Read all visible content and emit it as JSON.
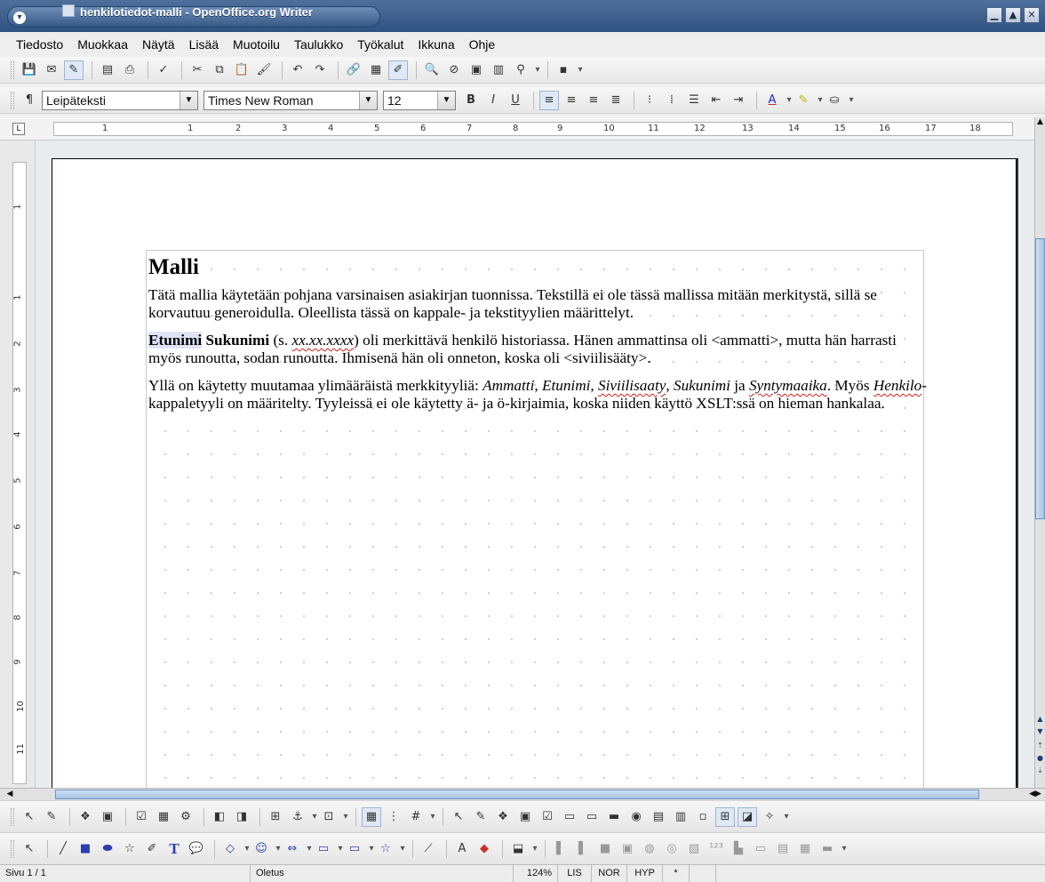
{
  "window": {
    "title": "henkilotiedot-malli - OpenOffice.org Writer"
  },
  "menubar": {
    "items": [
      {
        "label": "Tiedosto"
      },
      {
        "label": "Muokkaa"
      },
      {
        "label": "Näytä"
      },
      {
        "label": "Lisää"
      },
      {
        "label": "Muotoilu"
      },
      {
        "label": "Taulukko"
      },
      {
        "label": "Työkalut"
      },
      {
        "label": "Ikkuna"
      },
      {
        "label": "Ohje"
      }
    ]
  },
  "formatting": {
    "paragraph_style": "Leipäteksti",
    "font_name": "Times New Roman",
    "font_size": "12"
  },
  "ruler": {
    "h_marks": [
      "1",
      "1",
      "2",
      "3",
      "4",
      "5",
      "6",
      "7",
      "8",
      "9",
      "10",
      "11",
      "12",
      "13",
      "14",
      "15",
      "16",
      "17",
      "18"
    ],
    "v_marks": [
      "1",
      "1",
      "2",
      "3",
      "4",
      "5",
      "6",
      "7",
      "8",
      "9",
      "10",
      "11"
    ]
  },
  "document": {
    "heading": "Malli",
    "p1": "Tätä mallia käytetään pohjana varsinaisen asiakirjan tuonnissa. Tekstillä ei ole tässä mallissa mitään merkitystä, sillä se korvautuu generoidulla. Oleellista tässä on kappale- ja tekstityylien määrittelyt.",
    "p2": {
      "etunimi": "Etunimi",
      "sukunimi": "Sukunimi",
      "open": " (s. ",
      "date": "xx.xx.xxxx",
      "rest": ") oli merkittävä henkilö historiassa. Hänen ammattinsa oli <ammatti>, mutta hän harrasti myös runoutta, sodan runoutta. Ihmisenä hän oli onneton, koska oli <siviilisääty>."
    },
    "p3": {
      "intro": "Yllä on käytetty muutamaa ylimääräistä merkkityyliä: ",
      "ammatti": "Ammatti",
      "c1": ", ",
      "etunimi": "Etunimi",
      "c2": ", ",
      "siviilisaaty": "Siviilisaaty",
      "c3": ", ",
      "sukunimi": "Sukunimi",
      "ja": " ja ",
      "syntymaaika": "Syntymaaika",
      "mid": ". Myös ",
      "henkilo": "Henkilo",
      "end": "-kappaletyyli on määritelty. Tyyleissä ei ole käytetty ä- ja ö-kirjaimia, koska niiden käyttö XSLT:ssä on hieman hankalaa."
    }
  },
  "statusbar": {
    "page": "Sivu 1 / 1",
    "style": "Oletus",
    "zoom": "124%",
    "insert_mode": "LIS",
    "selection_mode": "NOR",
    "hyperlink_mode": "HYP",
    "modified": "*"
  }
}
